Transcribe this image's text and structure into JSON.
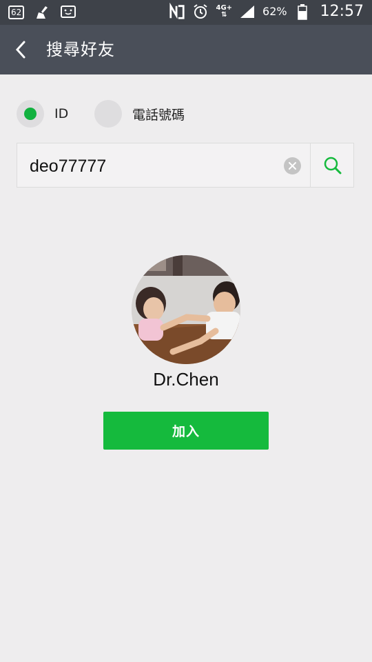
{
  "status_bar": {
    "badge_text": "62",
    "battery_percent": "62%",
    "time": "12:57",
    "network_label": "4G+",
    "icons": [
      "notification-badge-icon",
      "broom-icon",
      "face-box-icon",
      "nfc-icon",
      "alarm-icon",
      "network-4g-icon",
      "signal-icon",
      "battery-icon"
    ]
  },
  "header": {
    "back_icon": "chevron-left-icon",
    "title": "搜尋好友"
  },
  "search_type": {
    "options": [
      {
        "label": "ID",
        "selected": true
      },
      {
        "label": "電話號碼",
        "selected": false
      }
    ]
  },
  "search": {
    "value": "deo77777",
    "clear_icon": "clear-x-icon",
    "search_icon": "search-icon"
  },
  "result": {
    "name": "Dr.Chen",
    "add_label": "加入"
  },
  "colors": {
    "status_bar_bg": "#3e4249",
    "header_bg": "#4a4f59",
    "page_bg": "#eeedee",
    "accent_green": "#15ba3d"
  }
}
